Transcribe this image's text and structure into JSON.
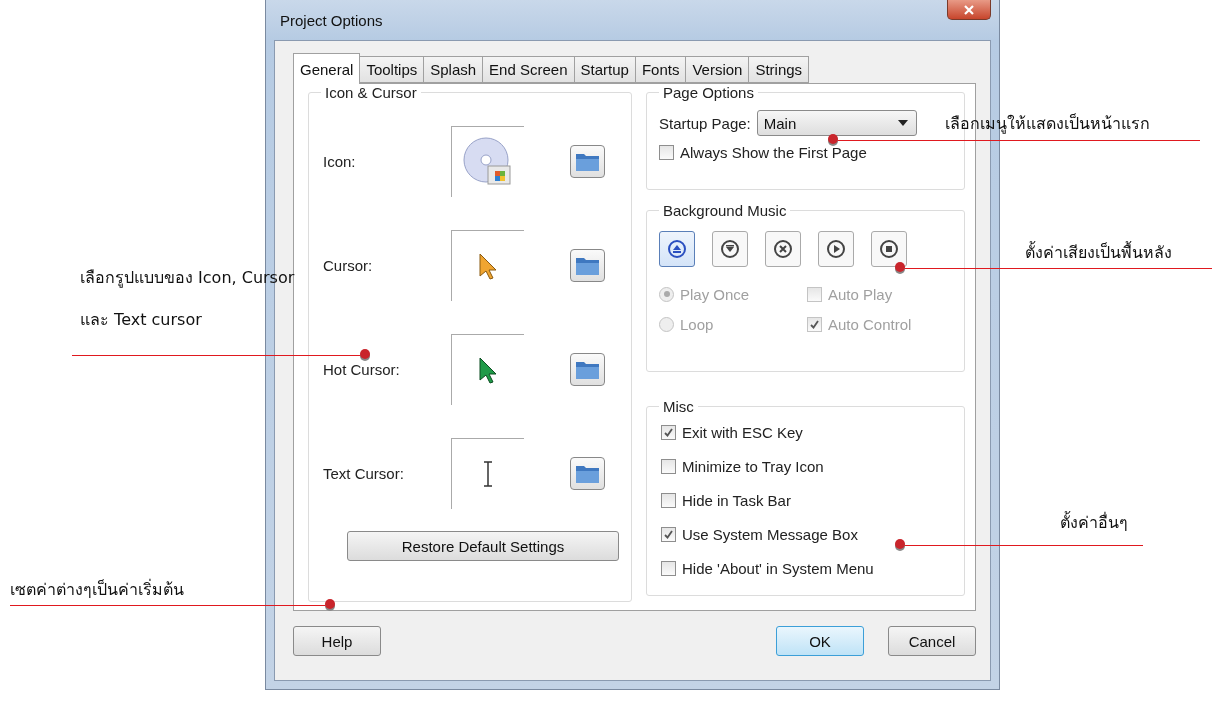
{
  "window": {
    "title": "Project Options"
  },
  "tabs": [
    {
      "label": "General",
      "selected": true
    },
    {
      "label": "Tooltips",
      "selected": false
    },
    {
      "label": "Splash",
      "selected": false
    },
    {
      "label": "End Screen",
      "selected": false
    },
    {
      "label": "Startup",
      "selected": false
    },
    {
      "label": "Fonts",
      "selected": false
    },
    {
      "label": "Version",
      "selected": false
    },
    {
      "label": "Strings",
      "selected": false
    }
  ],
  "icon_cursor": {
    "title": "Icon & Cursor",
    "rows": [
      {
        "label": "Icon:",
        "kind": "disc"
      },
      {
        "label": "Cursor:",
        "kind": "pointer"
      },
      {
        "label": "Hot Cursor:",
        "kind": "hot-pointer"
      },
      {
        "label": "Text Cursor:",
        "kind": "text"
      }
    ],
    "restore_button": "Restore Default Settings"
  },
  "page_options": {
    "title": "Page Options",
    "startup_label": "Startup Page:",
    "startup_value": "Main",
    "always_show": {
      "label": "Always Show the First Page",
      "checked": false
    }
  },
  "background_music": {
    "title": "Background Music",
    "buttons": [
      {
        "kind": "eject",
        "selected": true
      },
      {
        "kind": "down",
        "selected": false
      },
      {
        "kind": "close",
        "selected": false
      },
      {
        "kind": "play",
        "selected": false
      },
      {
        "kind": "stop",
        "selected": false
      }
    ],
    "options": [
      {
        "kind": "radio",
        "label": "Play Once",
        "checked": true,
        "disabled": true
      },
      {
        "kind": "checkbox",
        "label": "Auto Play",
        "checked": false,
        "disabled": true
      },
      {
        "kind": "radio",
        "label": "Loop",
        "checked": false,
        "disabled": true
      },
      {
        "kind": "checkbox",
        "label": "Auto Control",
        "checked": true,
        "disabled": true
      }
    ]
  },
  "misc": {
    "title": "Misc",
    "items": [
      {
        "label": "Exit with ESC Key",
        "checked": true
      },
      {
        "label": "Minimize to Tray Icon",
        "checked": false
      },
      {
        "label": "Hide in Task Bar",
        "checked": false
      },
      {
        "label": "Use System Message Box",
        "checked": true
      },
      {
        "label": "Hide 'About' in System Menu",
        "checked": false
      }
    ]
  },
  "buttons": [
    {
      "label": "Help",
      "default": false
    },
    {
      "label": "OK",
      "default": true
    },
    {
      "label": "Cancel",
      "default": false
    }
  ],
  "annotations": [
    {
      "lines": [
        "เลือกเมนูให้แสดงเป็นหน้าแรก"
      ]
    },
    {
      "lines": [
        "ตั้งค่าเสียงเป็นพื้นหลัง"
      ]
    },
    {
      "lines": [
        "เลือกรูปแบบของ Icon, Cursor",
        "และ Text cursor"
      ]
    },
    {
      "lines": [
        "เซตค่าต่างๆเป็นค่าเริ่มต้น"
      ]
    },
    {
      "lines": [
        "ตั้งค่าอื่นๆ"
      ]
    }
  ]
}
